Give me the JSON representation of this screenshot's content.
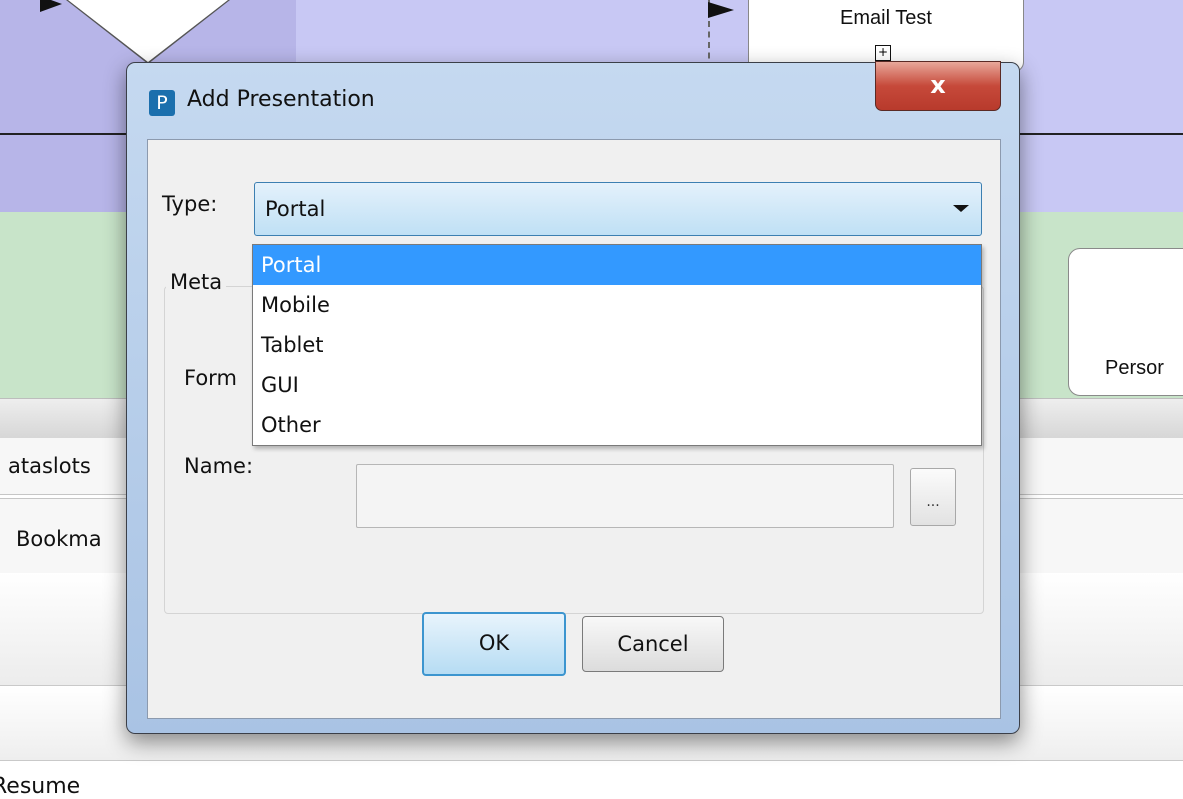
{
  "background": {
    "task_email_title": "Email Test",
    "task_email_plus": "+",
    "task_person_title": "Persor",
    "row_dataslots_label": "ataslots",
    "row_bookmarks_label": "Bookma",
    "bottom_text": "Resume"
  },
  "dialog": {
    "app_icon_letter": "P",
    "title": "Add Presentation",
    "close_label": "x",
    "type_label": "Type:",
    "type_value": "Portal",
    "group_title": "Meta",
    "format_label": "Form",
    "name_label": "Name:",
    "name_value": "",
    "browse_label": "...",
    "ok_label": "OK",
    "cancel_label": "Cancel"
  },
  "dropdown": {
    "options": [
      "Portal",
      "Mobile",
      "Tablet",
      "GUI",
      "Other"
    ],
    "selected": "Portal"
  },
  "colors": {
    "selection": "#3399ff",
    "lane_purple": "#c8c8f4",
    "lane_green": "#c8e4c9",
    "close_red": "#c6493a"
  }
}
